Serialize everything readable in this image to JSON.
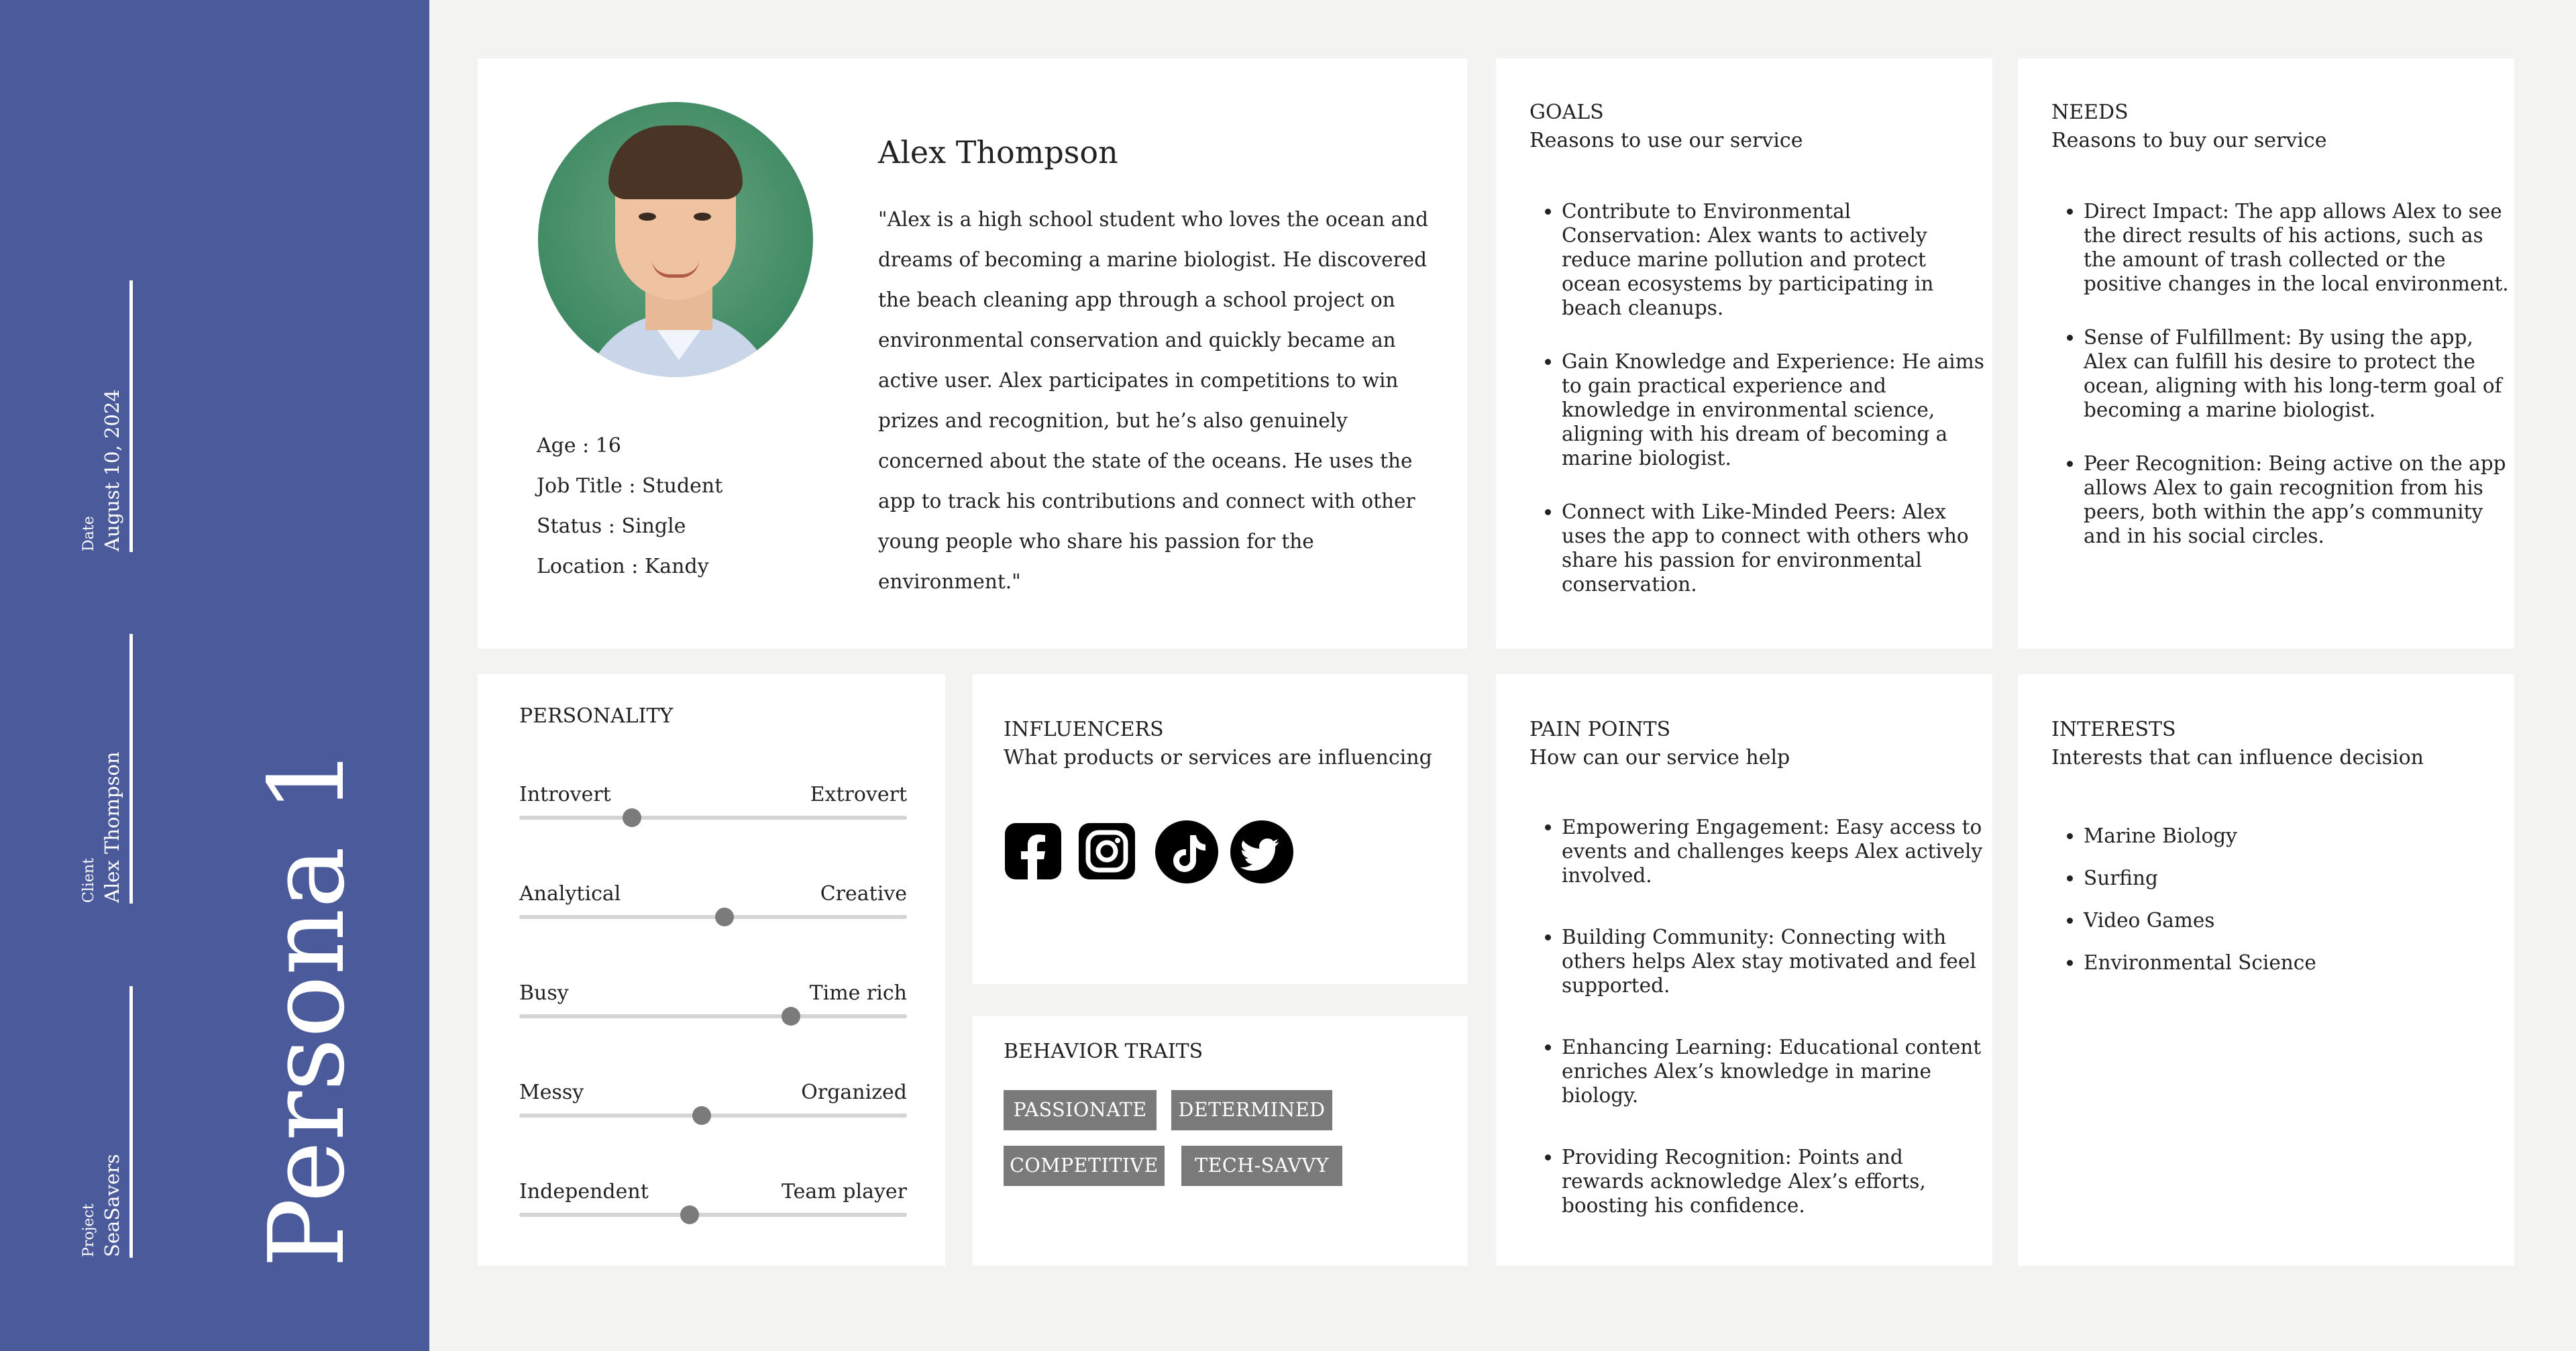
{
  "sidebar": {
    "date_label": "Date",
    "date_value": "August 10, 2024",
    "client_label": "Client",
    "client_value": "Alex Thompson",
    "project_label": "Project",
    "project_value": "SeaSavers",
    "persona_title": "Persona 1",
    "background_color": "#4a5a9b"
  },
  "profile": {
    "name": "Alex Thompson",
    "bio": "\"Alex is a high school student who loves the ocean and dreams of becoming a marine biologist. He discovered the beach cleaning app through a school project on environmental conservation and quickly became an active user. Alex participates in competitions to win prizes and recognition, but he’s also genuinely concerned about the state of the oceans. He uses the app to track his contributions and connect with other young people who share his passion for the environment.\"",
    "facts": [
      {
        "text": "Age : 16"
      },
      {
        "text": "Job Title : Student"
      },
      {
        "text": "Status : Single"
      },
      {
        "text": "Location : Kandy"
      }
    ]
  },
  "goals": {
    "title": "GOALS",
    "subtitle": "Reasons to use our service",
    "items": [
      "Contribute to Environmental Conservation: Alex wants to actively reduce marine pollution and protect ocean ecosystems by participating in beach cleanups.",
      "Gain Knowledge and Experience: He aims to gain practical experience and knowledge in environmental science, aligning with his dream of becoming a marine biologist.",
      "Connect with Like-Minded Peers: Alex uses the app to connect with others who share his passion for environmental conservation."
    ]
  },
  "needs": {
    "title": "NEEDS",
    "subtitle": "Reasons to buy our service",
    "items": [
      "Direct Impact: The app allows Alex to see the direct results of his actions, such as the amount of trash collected or the positive changes in the local environment.",
      "Sense of Fulfillment: By using the app, Alex can fulfill his desire to protect the ocean, aligning with his long-term goal of becoming a marine biologist.",
      "Peer Recognition: Being active on the app allows Alex to gain recognition from his peers, both within the app’s community and in his social circles."
    ]
  },
  "personality": {
    "title": "PERSONALITY",
    "sliders": [
      {
        "left": "Introvert",
        "right": "Extrovert",
        "value": 0.29
      },
      {
        "left": "Analytical",
        "right": "Creative",
        "value": 0.53
      },
      {
        "left": "Busy",
        "right": "Time rich",
        "value": 0.7
      },
      {
        "left": "Messy",
        "right": "Organized",
        "value": 0.47
      },
      {
        "left": "Independent",
        "right": "Team player",
        "value": 0.44
      }
    ]
  },
  "influencers": {
    "title": "INFLUENCERS",
    "subtitle": "What products or services are influencing",
    "icons": [
      "facebook-icon",
      "instagram-icon",
      "tiktok-icon",
      "twitter-icon"
    ]
  },
  "behavior": {
    "title": "BEHAVIOR TRAITS",
    "tags": [
      "PASSIONATE",
      "DETERMINED",
      "COMPETITIVE",
      "TECH-SAVVY"
    ],
    "tag_color": "#7a7a7a"
  },
  "pain_points": {
    "title": "PAIN POINTS",
    "subtitle": "How can our service help",
    "items": [
      "Empowering Engagement: Easy access to events and challenges keeps Alex actively involved.",
      "Building Community: Connecting with others helps Alex stay motivated and feel supported.",
      "Enhancing Learning: Educational content enriches Alex’s knowledge in marine biology.",
      "Providing Recognition: Points and rewards acknowledge Alex’s efforts, boosting his confidence."
    ]
  },
  "interests": {
    "title": "INTERESTS",
    "subtitle": "Interests that can influence decision",
    "items": [
      "Marine Biology",
      "Surfing",
      "Video Games",
      "Environmental Science"
    ]
  }
}
